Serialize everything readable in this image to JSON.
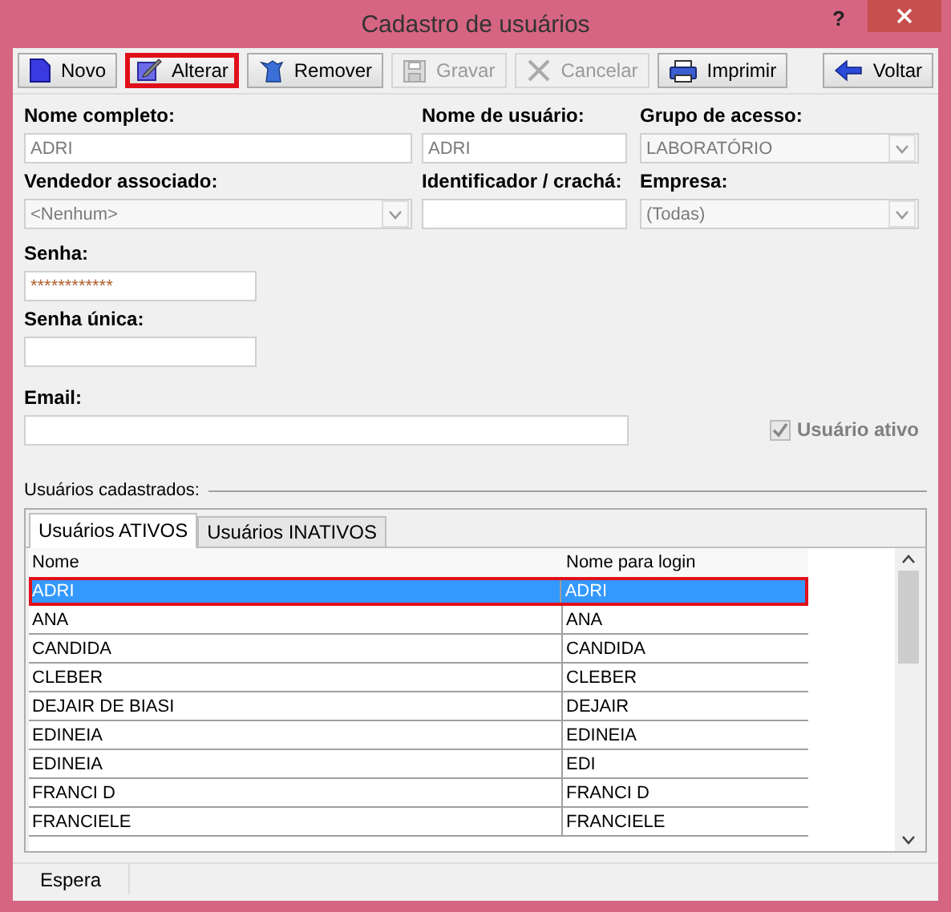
{
  "window": {
    "title": "Cadastro de usuários",
    "help": "?"
  },
  "toolbar": [
    {
      "label": "Novo",
      "disabled": false,
      "highlighted": false
    },
    {
      "label": "Alterar",
      "disabled": false,
      "highlighted": true
    },
    {
      "label": "Remover",
      "disabled": false,
      "highlighted": false
    },
    {
      "label": "Gravar",
      "disabled": true,
      "highlighted": false
    },
    {
      "label": "Cancelar",
      "disabled": true,
      "highlighted": false
    },
    {
      "label": "Imprimir",
      "disabled": false,
      "highlighted": false
    },
    {
      "label": "Voltar",
      "disabled": false,
      "highlighted": false
    }
  ],
  "fields": [
    {
      "label": "Nome completo:",
      "kind": "text",
      "value": "ADRI"
    },
    {
      "label": "Nome de usuário:",
      "kind": "text",
      "value": "ADRI"
    },
    {
      "label": "Grupo de acesso:",
      "kind": "select",
      "value": "LABORATÓRIO"
    },
    {
      "label": "Vendedor associado:",
      "kind": "select",
      "value": "<Nenhum>"
    },
    {
      "label": "Identificador / crachá:",
      "kind": "text"
    },
    {
      "label": "Empresa:",
      "kind": "select",
      "value": "(Todas)"
    },
    {
      "label": "Senha:",
      "kind": "password",
      "value": "************"
    },
    {
      "label": "Senha única:",
      "kind": "text"
    },
    {
      "label": "Email:",
      "kind": "text"
    }
  ],
  "active_checkbox": {
    "label": "Usuário ativo",
    "checked": true,
    "disabled": true
  },
  "group_title": "Usuários cadastrados:",
  "tabs": [
    {
      "label": "Usuários ATIVOS",
      "selected": true
    },
    {
      "label": "Usuários INATIVOS",
      "selected": false
    }
  ],
  "table": {
    "columns": [
      "Nome",
      "Nome para login"
    ],
    "rows": [
      {
        "cells": [
          "ADRI",
          "ADRI"
        ],
        "selected": true,
        "highlighted": true
      },
      {
        "cells": [
          "ANA",
          "ANA"
        ],
        "selected": false,
        "highlighted": false
      },
      {
        "cells": [
          "CANDIDA",
          "CANDIDA"
        ],
        "selected": false,
        "highlighted": false
      },
      {
        "cells": [
          "CLEBER",
          "CLEBER"
        ],
        "selected": false,
        "highlighted": false
      },
      {
        "cells": [
          "DEJAIR DE BIASI",
          "DEJAIR"
        ],
        "selected": false,
        "highlighted": false
      },
      {
        "cells": [
          "EDINEIA",
          "EDINEIA"
        ],
        "selected": false,
        "highlighted": false
      },
      {
        "cells": [
          "EDINEIA",
          "EDI"
        ],
        "selected": false,
        "highlighted": false
      },
      {
        "cells": [
          "FRANCI D",
          "FRANCI D"
        ],
        "selected": false,
        "highlighted": false
      },
      {
        "cells": [
          "FRANCIELE",
          "FRANCIELE"
        ],
        "selected": false,
        "highlighted": false
      }
    ]
  },
  "status_bar": [
    "Espera"
  ]
}
